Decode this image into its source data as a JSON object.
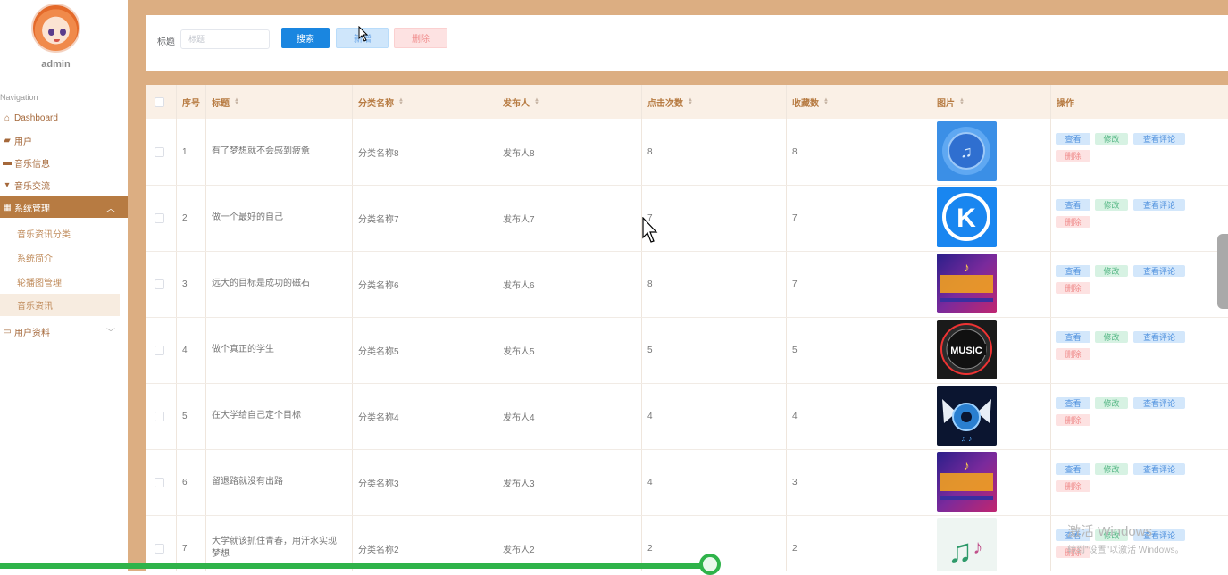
{
  "sidebar": {
    "username": "admin",
    "nav_title": "Navigation",
    "items": [
      {
        "label": "Dashboard",
        "icon": "home-icon"
      },
      {
        "label": "用户",
        "icon": "users-icon"
      },
      {
        "label": "音乐信息",
        "icon": "music-icon"
      },
      {
        "label": "音乐交流",
        "icon": "chat-icon"
      },
      {
        "label": "系统管理",
        "icon": "grid-icon"
      }
    ],
    "sub_items": [
      "音乐资讯分类",
      "系统简介",
      "轮播图管理",
      "音乐资讯"
    ],
    "last_item": {
      "label": "用户资料",
      "icon": "profile-icon"
    }
  },
  "search": {
    "label": "标题",
    "placeholder": "标题",
    "search_btn": "搜索",
    "add_btn": "新增",
    "delete_btn": "删除"
  },
  "table": {
    "headers": [
      "序号",
      "标题",
      "分类名称",
      "发布人",
      "点击次数",
      "收藏数",
      "图片",
      "操作"
    ],
    "actions": {
      "view": "查看",
      "edit": "修改",
      "comments": "查看评论",
      "delete": "删除"
    },
    "rows": [
      {
        "index": "1",
        "title": "有了梦想就不会感到疲惫",
        "category": "分类名称8",
        "publisher": "发布人8",
        "clicks": "8",
        "favorites": "8",
        "image": "blue-music-disc"
      },
      {
        "index": "2",
        "title": "做一个最好的自己",
        "category": "分类名称7",
        "publisher": "发布人7",
        "clicks": "7",
        "favorites": "7",
        "image": "kugou-k-logo"
      },
      {
        "index": "3",
        "title": "远大的目标是成功的磁石",
        "category": "分类名称6",
        "publisher": "发布人6",
        "clicks": "8",
        "favorites": "7",
        "image": "music-poster-purple"
      },
      {
        "index": "4",
        "title": "做个真正的学生",
        "category": "分类名称5",
        "publisher": "发布人5",
        "clicks": "5",
        "favorites": "5",
        "image": "music-badge-dark"
      },
      {
        "index": "5",
        "title": "在大学给自己定个目标",
        "category": "分类名称4",
        "publisher": "发布人4",
        "clicks": "4",
        "favorites": "4",
        "image": "winged-speaker"
      },
      {
        "index": "6",
        "title": "留退路就没有出路",
        "category": "分类名称3",
        "publisher": "发布人3",
        "clicks": "4",
        "favorites": "3",
        "image": "music-poster-purple"
      },
      {
        "index": "7",
        "title": "大学就该抓住青春，用汗水实现梦想",
        "category": "分类名称2",
        "publisher": "发布人2",
        "clicks": "2",
        "favorites": "2",
        "image": "music-notes"
      }
    ]
  },
  "watermark": {
    "line1": "激活 Windows",
    "line2": "转到\"设置\"以激活 Windows。"
  },
  "colors": {
    "sidebar_active": "#b77b42",
    "main_bg": "#dcae82",
    "primary": "#1a86e0",
    "progress": "#2fb34a"
  }
}
